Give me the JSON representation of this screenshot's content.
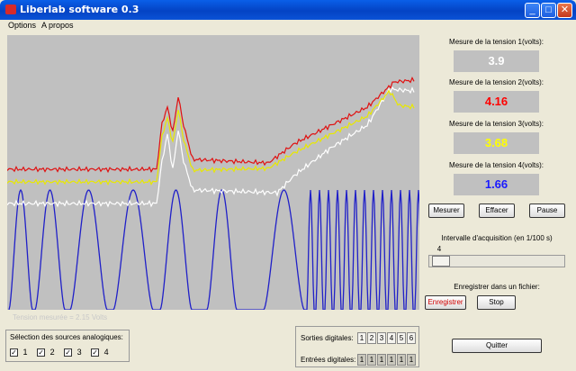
{
  "window": {
    "title": "Liberlab software 0.3",
    "minimize": "_",
    "maximize": "□",
    "close": "✕"
  },
  "menu": {
    "options": "Options",
    "about": "A propos"
  },
  "plot": {
    "background": "#c0c0c0",
    "status_text": "Tension mesurée = 2.15 Volts"
  },
  "measurements": [
    {
      "label": "Mesure de la tension 1(volts):",
      "value": "3.9",
      "color": "#ffffff"
    },
    {
      "label": "Mesure de la tension 2(volts):",
      "value": "4.16",
      "color": "#ff0000"
    },
    {
      "label": "Mesure de la tension 3(volts):",
      "value": "3.68",
      "color": "#ffff00"
    },
    {
      "label": "Mesure de la tension 4(volts):",
      "value": "1.66",
      "color": "#1a1aff"
    }
  ],
  "buttons": {
    "measure": "Mesurer",
    "clear": "Effacer",
    "pause": "Pause",
    "record": "Enregistrer",
    "stop": "Stop",
    "quit": "Quitter"
  },
  "interval": {
    "label": "Intervalle d'acquisition (en 1/100 s)",
    "value": "4"
  },
  "save": {
    "label": "Enregistrer dans un fichier:"
  },
  "analog_sources": {
    "title": "Sélection des sources analogiques:",
    "items": [
      "1",
      "2",
      "3",
      "4"
    ],
    "check": "✓"
  },
  "digital": {
    "outputs_label": "Sorties digitales:",
    "outputs": [
      "1",
      "2",
      "3",
      "4",
      "5",
      "6"
    ],
    "inputs_label": "Entrées digitales:",
    "inputs": [
      "1",
      "1",
      "1",
      "1",
      "1",
      "1"
    ]
  }
}
